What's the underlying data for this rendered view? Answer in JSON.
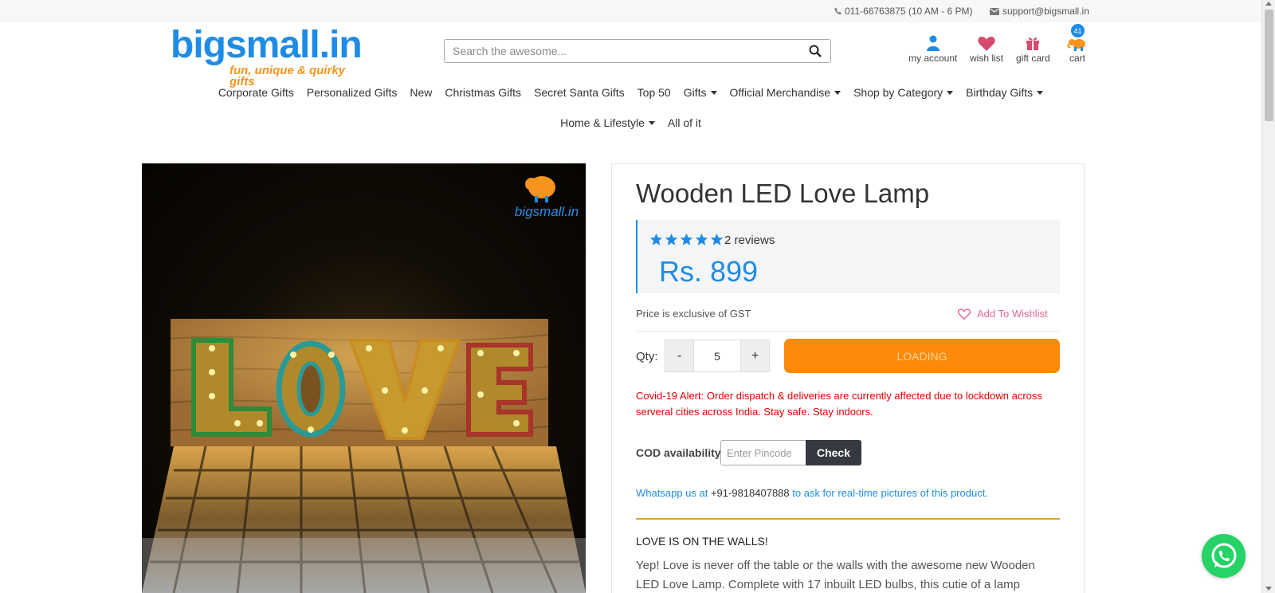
{
  "topbar": {
    "phone": "011-66763875 (10 AM - 6 PM)",
    "email": "support@bigsmall.in"
  },
  "logo": {
    "name": "bigsmall.in",
    "tagline": "fun, unique & quirky gifts"
  },
  "search": {
    "placeholder": "Search the awesome..."
  },
  "header_icons": {
    "account": "my account",
    "wishlist": "wish list",
    "giftcard": "gift card",
    "cart": "cart",
    "cart_count": "41"
  },
  "nav": {
    "row1": [
      {
        "label": "Corporate Gifts",
        "dropdown": false
      },
      {
        "label": "Personalized Gifts",
        "dropdown": false
      },
      {
        "label": "New",
        "dropdown": false
      },
      {
        "label": "Christmas Gifts",
        "dropdown": false
      },
      {
        "label": "Secret Santa Gifts",
        "dropdown": false
      },
      {
        "label": "Top 50",
        "dropdown": false
      },
      {
        "label": "Gifts",
        "dropdown": true
      },
      {
        "label": "Official Merchandise",
        "dropdown": true
      },
      {
        "label": "Shop by Category",
        "dropdown": true
      },
      {
        "label": "Birthday Gifts",
        "dropdown": true
      }
    ],
    "row2": [
      {
        "label": "Home & Lifestyle",
        "dropdown": true
      },
      {
        "label": "All of it",
        "dropdown": false
      }
    ]
  },
  "product": {
    "image_letters": "LOVE",
    "watermark": "bigsmall.in",
    "title": "Wooden LED Love Lamp",
    "rating_stars": 5,
    "reviews": "2 reviews",
    "price": "Rs. 899",
    "gst_note": "Price is exclusive of GST",
    "wishlist_label": "Add To Wishlist",
    "qty_label": "Qty:",
    "qty_minus": "-",
    "qty_value": "5",
    "qty_plus": "+",
    "add_button": "LOADING",
    "alert": "Covid-19 Alert: Order dispatch & deliveries are currently affected due to lockdown across serveral cities across India. Stay safe. Stay indoors.",
    "cod_label": "COD availability",
    "pincode_placeholder": "Enter Pincode",
    "check_label": "Check",
    "whatsapp_prefix": "Whatsapp us at",
    "whatsapp_number": "+91-9818407888",
    "whatsapp_suffix": "to ask for real-time pictures of this product.",
    "heading": "LOVE IS ON THE WALLS!",
    "description": "Yep! Love is never off the table or the walls with the awesome new Wooden LED Love Lamp. Complete with 17 inbuilt LED bulbs, this cutie of a lamp exudes"
  },
  "colors": {
    "brand_blue": "#1e8ce6",
    "brand_orange": "#fd8a0a",
    "alert_red": "#e00000",
    "wishlist_pink": "#e46a8c",
    "whatsapp_green": "#25d366"
  }
}
